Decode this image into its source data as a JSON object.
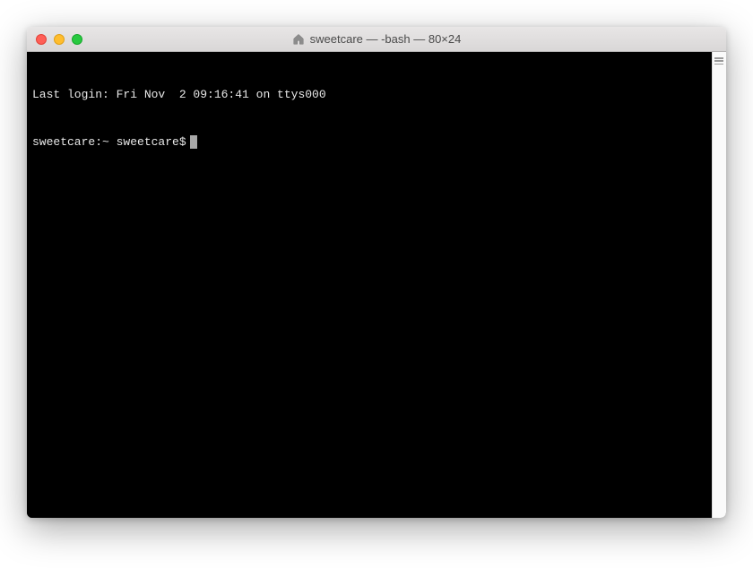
{
  "window": {
    "title": "sweetcare — -bash — 80×24"
  },
  "terminal": {
    "last_login": "Last login: Fri Nov  2 09:16:41 on ttys000",
    "prompt": "sweetcare:~ sweetcare$"
  }
}
